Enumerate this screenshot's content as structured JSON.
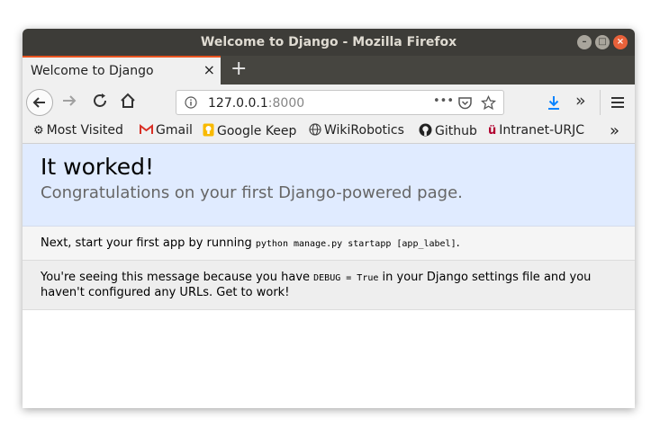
{
  "window": {
    "title": "Welcome to Django - Mozilla Firefox"
  },
  "tab": {
    "title": "Welcome to Django",
    "close": "×",
    "new": "+"
  },
  "toolbar": {
    "url_host": "127.0.0.1",
    "url_port": ":8000",
    "more": "•••"
  },
  "bookmarks": [
    {
      "label": "Most Visited",
      "icon": "gear-icon"
    },
    {
      "label": "Gmail",
      "icon": "gmail-icon"
    },
    {
      "label": "Google Keep",
      "icon": "keep-icon"
    },
    {
      "label": "WikiRobotics",
      "icon": "globe-icon"
    },
    {
      "label": "Github",
      "icon": "github-icon"
    },
    {
      "label": "Intranet-URJC",
      "icon": "urjc-icon"
    }
  ],
  "page": {
    "heading": "It worked!",
    "subheading": "Congratulations on your first Django-powered page.",
    "instr_pre": "Next, start your first app by running ",
    "instr_code": "python manage.py startapp [app_label]",
    "instr_post": ".",
    "expl_pre": "You're seeing this message because you have ",
    "expl_code": "DEBUG = True",
    "expl_post1": " in your Django settings file and you",
    "expl_post2": "haven't configured any URLs. Get to work!"
  },
  "colors": {
    "accent": "#e95420",
    "summary_bg": "#e0ebff",
    "download": "#0a84ff"
  }
}
